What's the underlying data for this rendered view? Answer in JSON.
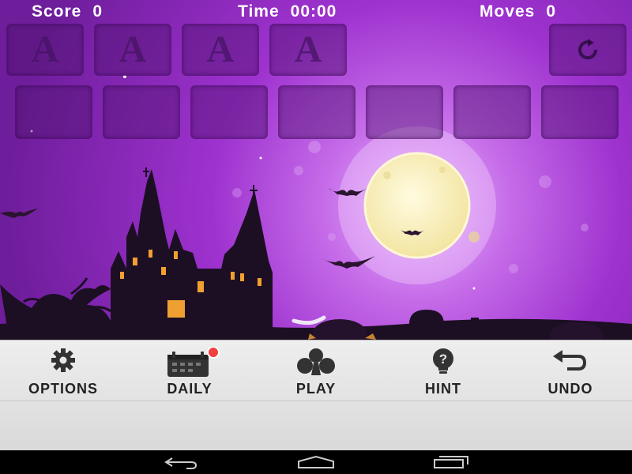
{
  "hud": {
    "score_label": "Score",
    "score_value": "0",
    "time_label": "Time",
    "time_value": "00:00",
    "moves_label": "Moves",
    "moves_value": "0"
  },
  "foundations": [
    "A",
    "A",
    "A",
    "A"
  ],
  "toolbar": {
    "options_label": "OPTIONS",
    "daily_label": "DAILY",
    "play_label": "PLAY",
    "hint_label": "HINT",
    "undo_label": "UNDO"
  },
  "icons": {
    "options": "gear-icon",
    "daily": "calendar-icon",
    "play": "club-icon",
    "hint": "lightbulb-question-icon",
    "undo": "undo-arrow-icon",
    "stock": "refresh-icon",
    "nav_back": "back-icon",
    "nav_home": "home-icon",
    "nav_recent": "recent-apps-icon"
  },
  "colors": {
    "sky": "#9e32cf",
    "moon": "#fbf3c4",
    "notification": "#f04040",
    "toolbar_bg": "#e6e6e6"
  }
}
